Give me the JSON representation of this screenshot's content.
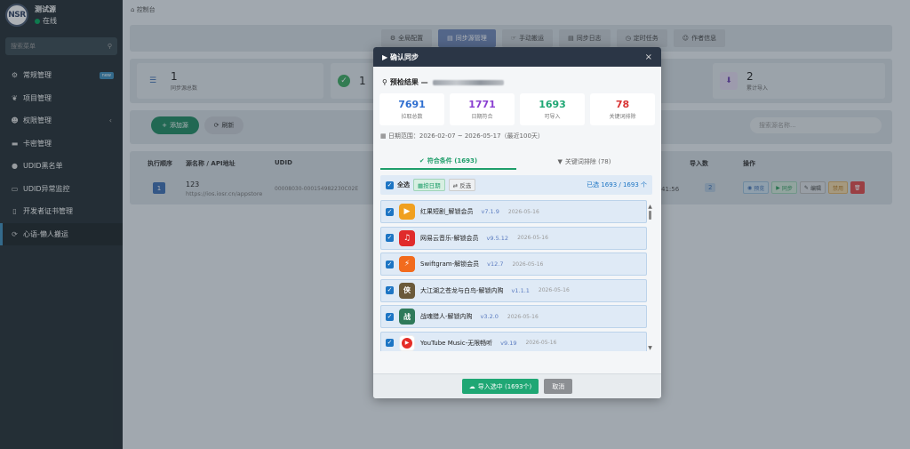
{
  "sidebar": {
    "avatar_text": "NSR",
    "user_name": "测试源",
    "status": "在线",
    "search_placeholder": "搜索菜单",
    "new_badge": "new",
    "items": [
      {
        "label": "常规管理",
        "icon": "cogs-icon"
      },
      {
        "label": "项目管理",
        "icon": "leaf-icon"
      },
      {
        "label": "权限管理",
        "icon": "users-icon"
      },
      {
        "label": "卡密管理",
        "icon": "card-icon"
      },
      {
        "label": "UDID黑名单",
        "icon": "bomb-icon"
      },
      {
        "label": "UDID异常监控",
        "icon": "desktop-icon"
      },
      {
        "label": "开发者证书管理",
        "icon": "file-icon"
      },
      {
        "label": "心语-懒人搬运",
        "icon": "sync-icon"
      }
    ]
  },
  "breadcrumb": "控制台",
  "tabs": [
    "全局配置",
    "同步源管理",
    "手动搬运",
    "同步日志",
    "定时任务",
    "作者信息"
  ],
  "stats": [
    {
      "value": "1",
      "label": "同步源总数"
    },
    {
      "value": "1",
      "label": ""
    },
    {
      "value": "2",
      "label": "累计导入"
    }
  ],
  "toolbar": {
    "add": "添加源",
    "refresh": "刷新",
    "search_placeholder": "搜索源名称..."
  },
  "table": {
    "headers": [
      "执行顺序",
      "源名称 / API地址",
      "UDID",
      "导入数",
      "操作"
    ],
    "row": {
      "order": "1",
      "name": "123",
      "url": "https://ios.iosr.cn/appstore",
      "udid": "00008030-000154982230C02E",
      "time": "41:56",
      "count": "2"
    },
    "ops": [
      "预览",
      "同步",
      "编辑",
      "禁用"
    ]
  },
  "modal": {
    "title": "确认同步",
    "close": "×",
    "precheck_label": "预检结果 —",
    "stats": [
      {
        "value": "7691",
        "label": "拉取总数",
        "color": "#2f6fd0"
      },
      {
        "value": "1771",
        "label": "日期符合",
        "color": "#8a3fd1"
      },
      {
        "value": "1693",
        "label": "可导入",
        "color": "#1fa774"
      },
      {
        "value": "78",
        "label": "关键词排除",
        "color": "#d93434"
      }
    ],
    "date_range": "日期范围：2026-02-07 ~ 2026-05-17（最近100天）",
    "tab_match": "符合条件 (1693)",
    "tab_exclude": "关键词排除 (78)",
    "select_all": "全选",
    "by_date": "按日期",
    "invert": "反选",
    "selected": "已选 1693 / 1693 个",
    "apps": [
      {
        "name": "红果短剧_解锁会员",
        "version": "v7.1.9",
        "date": "2026-05-16",
        "color": "#f0a020",
        "glyph": "▶"
      },
      {
        "name": "网易云音乐-解锁会员",
        "version": "v9.5.12",
        "date": "2026-05-16",
        "color": "#e02b2b",
        "glyph": "♫"
      },
      {
        "name": "Swiftgram-解锁会员",
        "version": "v12.7",
        "date": "2026-05-16",
        "color": "#f26b1d",
        "glyph": "⚡"
      },
      {
        "name": "大江湖之苍龙与白鸟-解锁内购",
        "version": "v1.1.1",
        "date": "2026-05-16",
        "color": "#6b5a3a",
        "glyph": "侠"
      },
      {
        "name": "战魂猎人-解锁内购",
        "version": "v3.2.0",
        "date": "2026-05-16",
        "color": "#2f7a5a",
        "glyph": "战"
      },
      {
        "name": "YouTube Music-无限畅听",
        "version": "v9.19",
        "date": "2026-05-16",
        "color": "#e52d27",
        "glyph": "▶"
      }
    ],
    "import_button": "导入选中 (1693个)",
    "cancel_button": "取消"
  }
}
